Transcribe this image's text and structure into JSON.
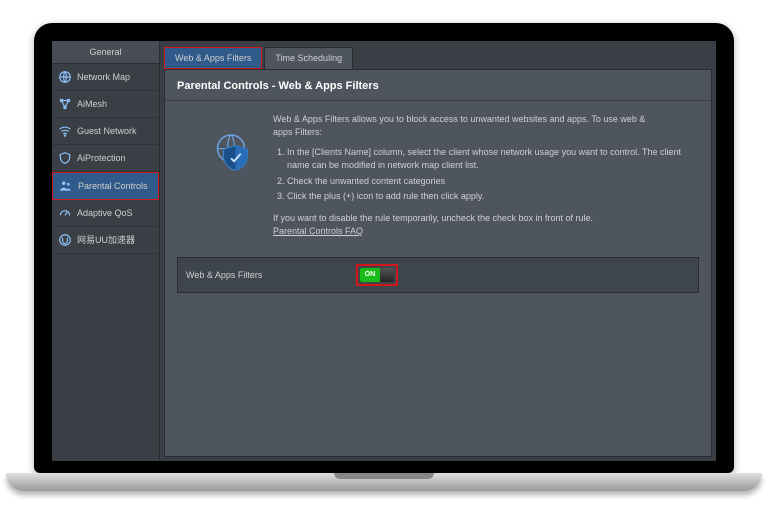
{
  "sidebar": {
    "header": "General",
    "items": [
      {
        "label": "Network Map"
      },
      {
        "label": "AiMesh"
      },
      {
        "label": "Guest Network"
      },
      {
        "label": "AiProtection"
      },
      {
        "label": "Parental Controls"
      },
      {
        "label": "Adaptive QoS"
      },
      {
        "label": "网易UU加速器"
      }
    ]
  },
  "tabs": [
    {
      "label": "Web & Apps Filters"
    },
    {
      "label": "Time Scheduling"
    }
  ],
  "page": {
    "title": "Parental Controls - Web & Apps Filters",
    "intro": "Web & Apps Filters allows you to block access to unwanted websites and apps. To use web & apps Filters:",
    "steps": [
      "In the [Clients Name] column, select the client whose network usage you want to control. The client name can be modified in network map client list.",
      "Check the unwanted content categories",
      "Click the plus (+) icon to add rule then click apply."
    ],
    "disable_note": "If you want to disable the rule temporarily, uncheck the check box in front of rule.",
    "faq_label": "Parental Controls FAQ"
  },
  "toggle": {
    "label": "Web & Apps Filters",
    "state": "ON"
  },
  "colors": {
    "highlight": "#d01818",
    "active_bg": "#2f5a8a",
    "toggle_on": "#1abc1a"
  }
}
